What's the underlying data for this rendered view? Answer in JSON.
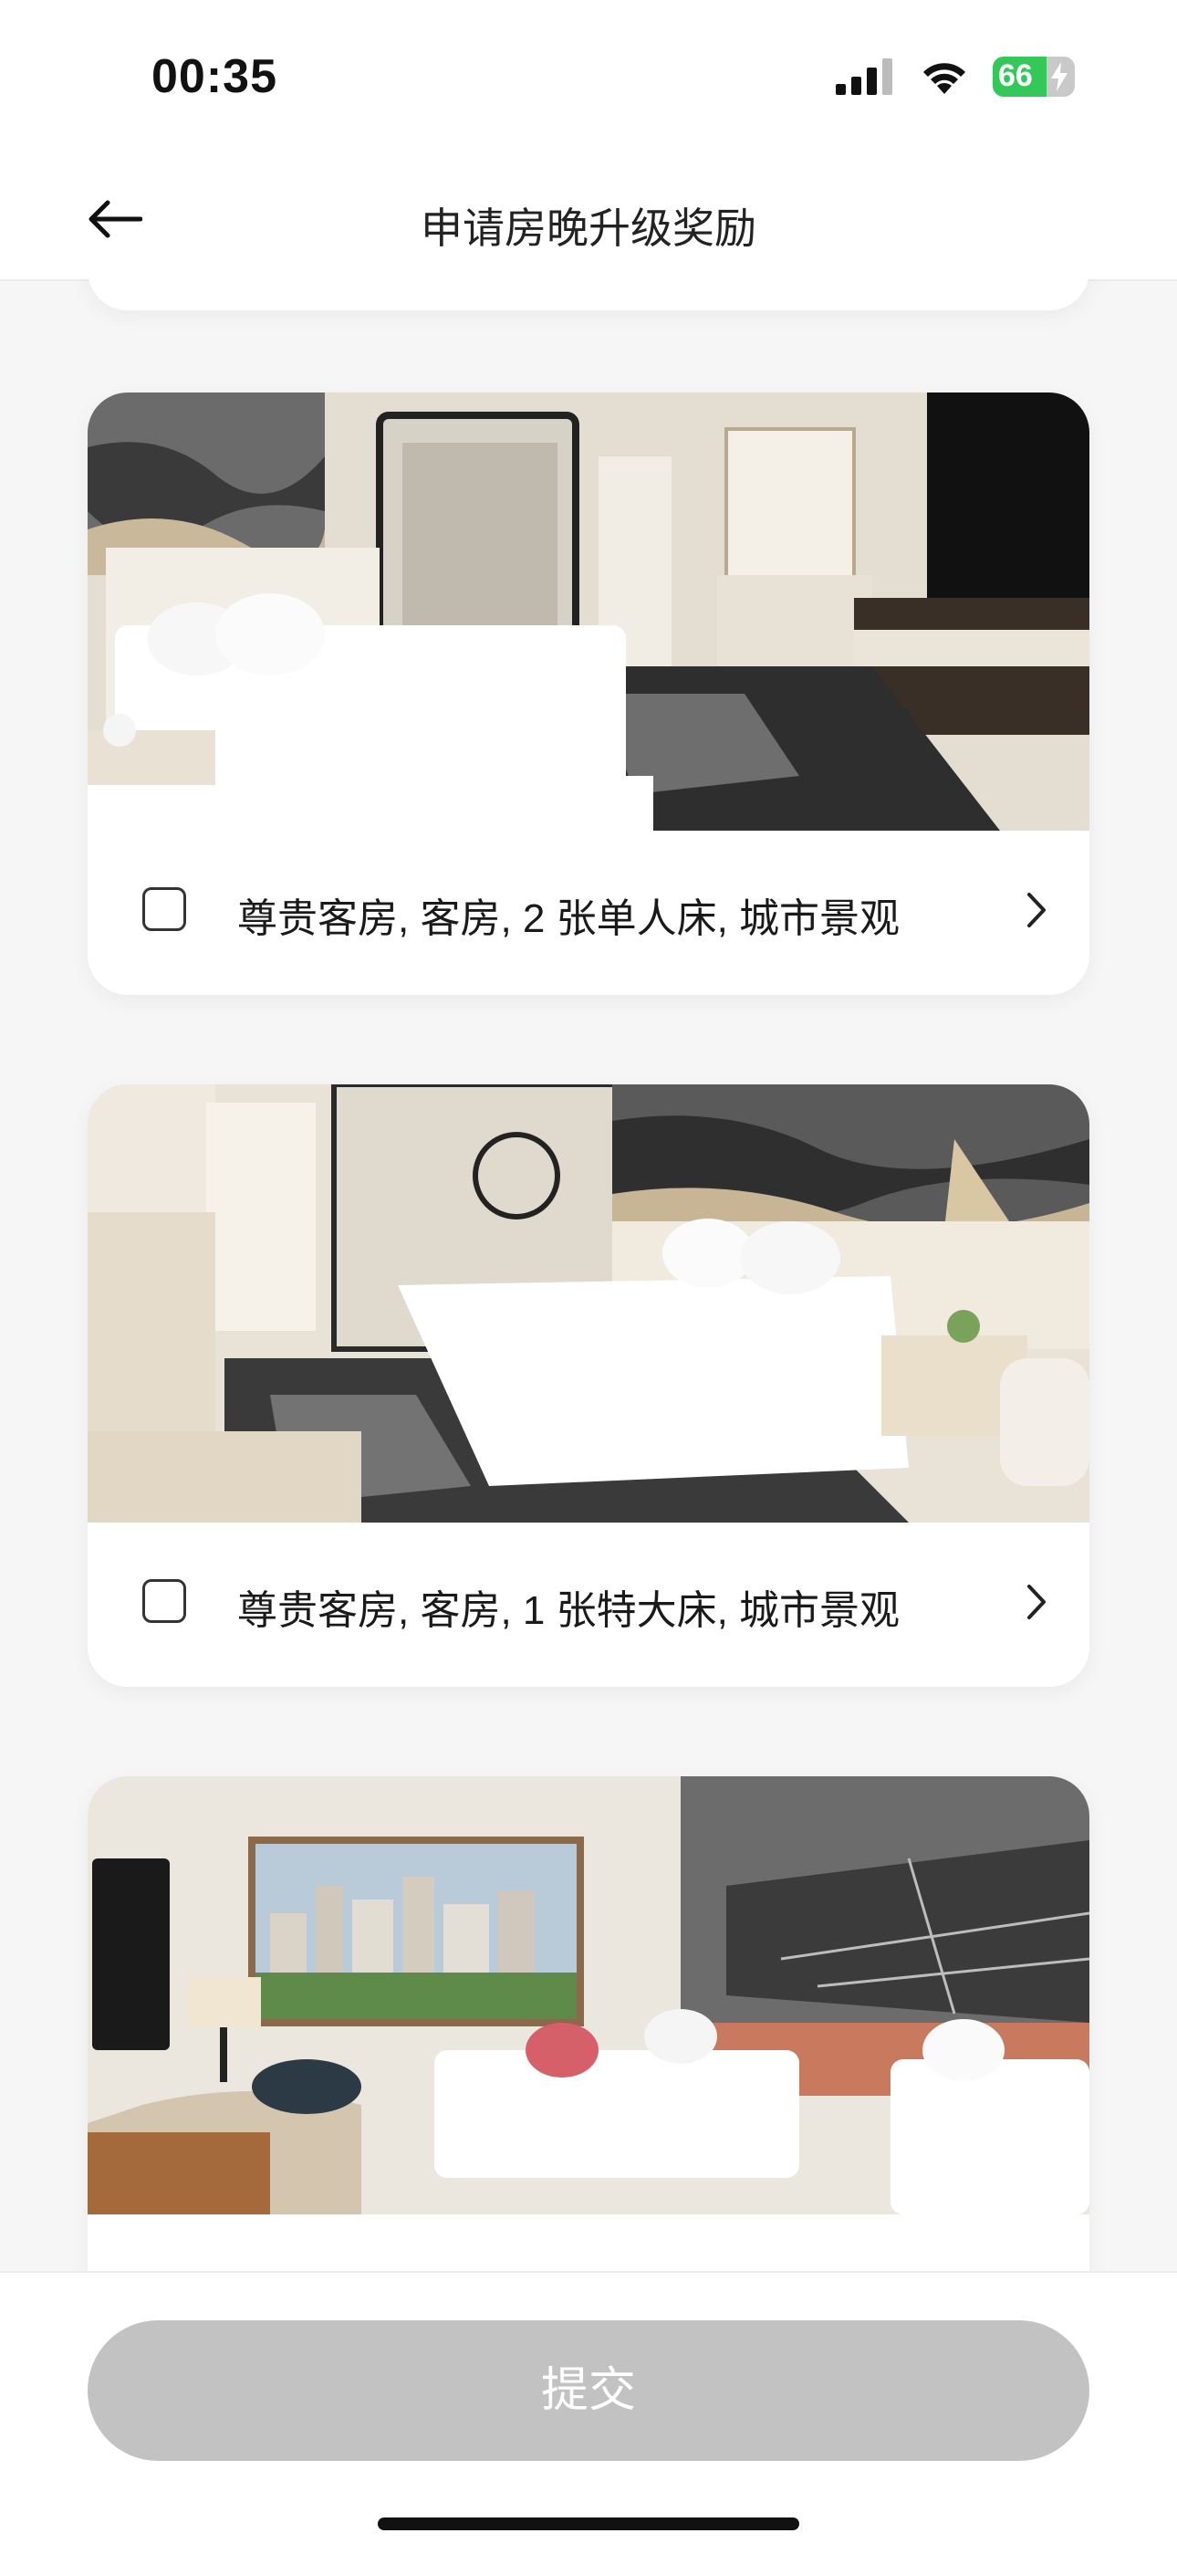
{
  "status_bar": {
    "time": "00:35",
    "battery": "66",
    "battery_level": 0.66
  },
  "nav": {
    "title": "申请房晚升级奖励"
  },
  "rooms": [
    {
      "label": "尊贵客房, 客房, 2 张单人床, 城市景观",
      "image_icon": "twin-bed-room-photo",
      "selected": false
    },
    {
      "label": "尊贵客房, 客房, 1 张特大床, 城市景观",
      "image_icon": "king-bed-room-photo",
      "selected": false
    },
    {
      "label": "",
      "image_icon": "city-view-twin-room-photo",
      "selected": false
    }
  ],
  "footer": {
    "submit_label": "提交"
  },
  "colors": {
    "submit_disabled": "#c2c2c2",
    "battery_green": "#34c759",
    "background": "#f6f6f6"
  }
}
